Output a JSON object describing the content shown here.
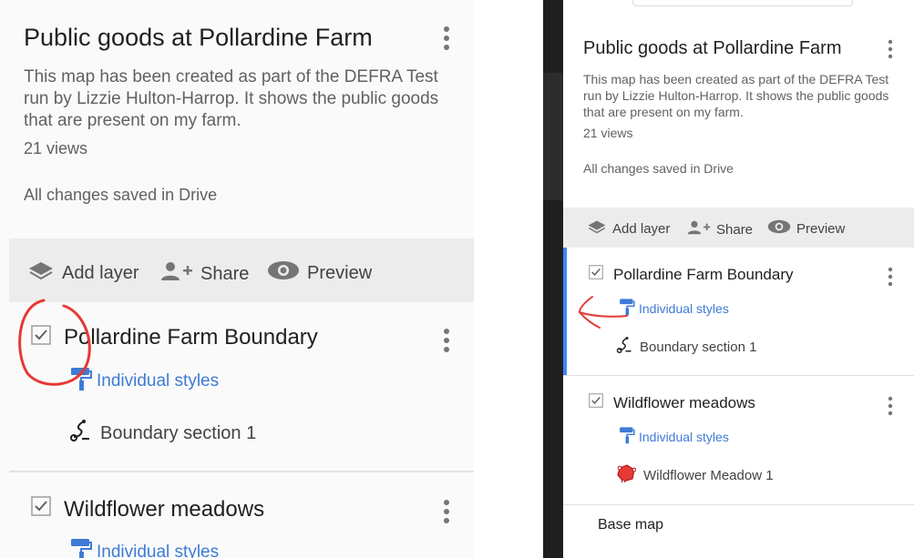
{
  "left_panel": {
    "title": "Public goods at Pollardine Farm",
    "description": "This map has been created as part of the DEFRA Test run by Lizzie Hulton-Harrop. It shows the public goods that are present on my farm.",
    "views": "21 views",
    "save_status": "All changes saved in Drive",
    "toolbar": {
      "add_layer": "Add layer",
      "share": "Share",
      "preview": "Preview"
    },
    "layers": [
      {
        "name": "Pollardine Farm Boundary",
        "checked": true,
        "style": "Individual styles",
        "feature": "Boundary section 1"
      },
      {
        "name": "Wildflower meadows",
        "checked": true,
        "style": "Individual styles"
      }
    ]
  },
  "right_panel": {
    "title": "Public goods at Pollardine Farm",
    "description": "This map has been created as part of the DEFRA Test run by Lizzie Hulton-Harrop. It shows the public goods that are present on my farm.",
    "views": "21 views",
    "save_status": "All changes saved in Drive",
    "toolbar": {
      "add_layer": "Add layer",
      "share": "Share",
      "preview": "Preview"
    },
    "layers": [
      {
        "name": "Pollardine Farm Boundary",
        "checked": true,
        "style": "Individual styles",
        "feature": "Boundary section 1"
      },
      {
        "name": "Wildflower meadows",
        "checked": true,
        "style": "Individual styles",
        "feature": "Wildflower Meadow 1"
      }
    ],
    "base_map": "Base map"
  },
  "colors": {
    "style_link": "#3e7bd6",
    "active_layer_bar": "#4285f4",
    "annotation": "#e53935",
    "polygon_fill": "#e53935"
  }
}
